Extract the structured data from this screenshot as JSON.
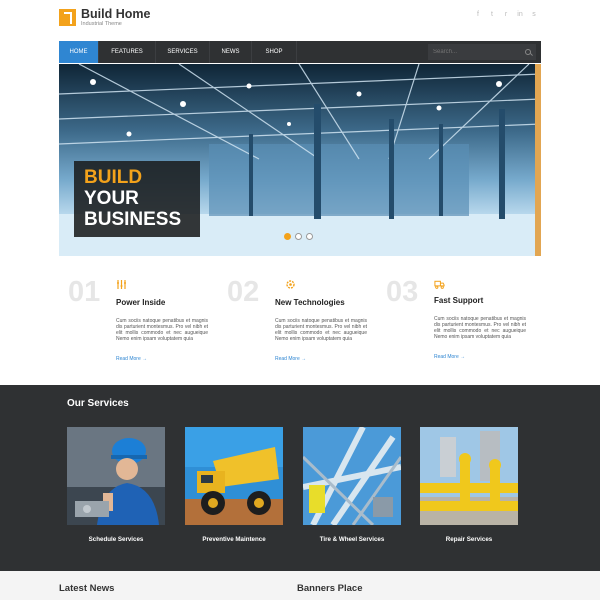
{
  "brand": {
    "title": "Build Home",
    "tagline": "Industrial Theme",
    "accent": "#f3a21b",
    "link": "#2f86d2"
  },
  "social": [
    {
      "icon": "facebook-icon",
      "glyph": "f"
    },
    {
      "icon": "twitter-icon",
      "glyph": "t"
    },
    {
      "icon": "rss-icon",
      "glyph": "r"
    },
    {
      "icon": "linkedin-icon",
      "glyph": "in"
    },
    {
      "icon": "skype-icon",
      "glyph": "s"
    }
  ],
  "nav": {
    "items": [
      "HOME",
      "FEATURES",
      "SERVICES",
      "NEWS",
      "SHOP"
    ],
    "active": 0,
    "search_placeholder": "Search..."
  },
  "hero": {
    "line1": "BUILD",
    "line2": "YOUR",
    "line3": "BUSINESS",
    "slides": 3,
    "active_slide": 0
  },
  "features": [
    {
      "num": "01",
      "icon": "power-bars-icon",
      "title": "Power Inside",
      "text": "Cum sociis natoque penatibus et magnis dis parturient montesmus. Pro vel nibh et elit mollis commodo et nec augueique Nemo enim ipsam voluptatem quia",
      "more": "Read More →"
    },
    {
      "num": "02",
      "icon": "gear-icon",
      "title": "New Technologies",
      "text": "Cum sociis natoque penatibus et magnis dis parturient montesmus. Pro vel nibh et elit mollis commodo et nec augueique Nemo enim ipsam voluptatem quia",
      "more": "Read More →"
    },
    {
      "num": "03",
      "icon": "truck-icon",
      "title": "Fast Support",
      "text": "Cum sociis natoque penatibus et magnis dis parturient montesmus. Pro vel nibh et elit mollis commodo et nec augueique Nemo enim ipsam voluptatem quia",
      "more": "Read More →"
    }
  ],
  "services": {
    "heading": "Our Services",
    "items": [
      {
        "caption": "Schedule Services",
        "image": "worker-hardhat-image"
      },
      {
        "caption": "Preventive Maintence",
        "image": "dump-truck-image"
      },
      {
        "caption": "Tire & Wheel Services",
        "image": "industrial-pipes-image"
      },
      {
        "caption": "Repair Services",
        "image": "yellow-pipeline-image"
      }
    ]
  },
  "bottom": {
    "latest_news": "Latest News",
    "banners": "Banners Place"
  }
}
